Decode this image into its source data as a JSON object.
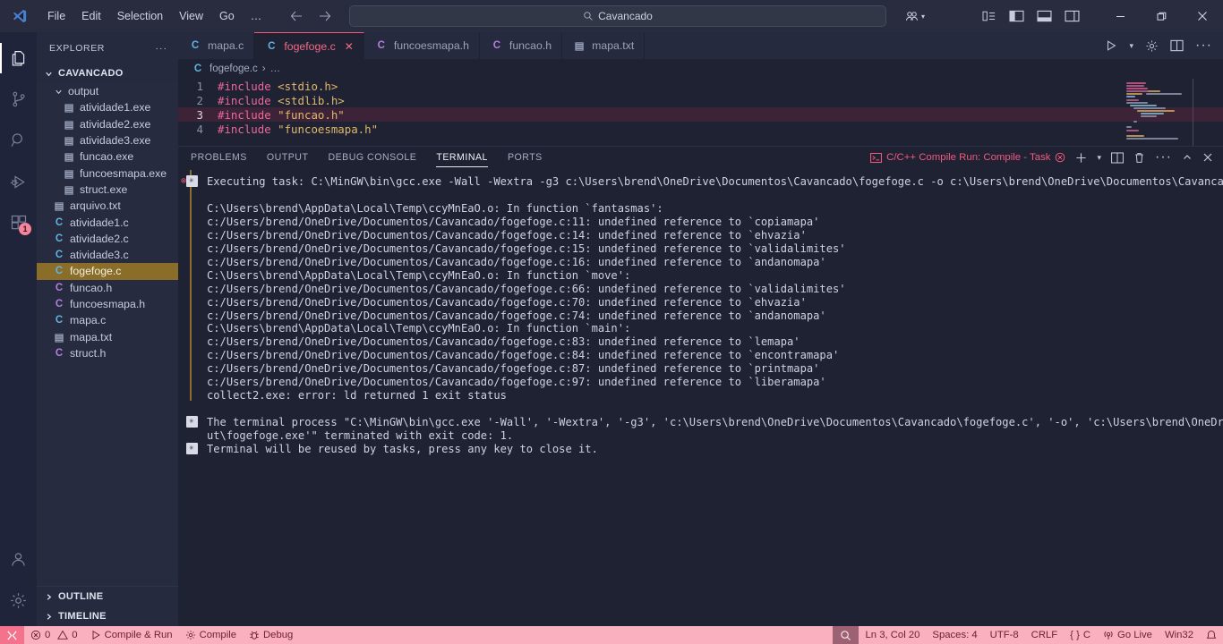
{
  "titlebar": {
    "menus": [
      "File",
      "Edit",
      "Selection",
      "View",
      "Go",
      "…"
    ],
    "back_icon": "arrow-left-icon",
    "forward_icon": "arrow-right-icon",
    "search_value": "Cavancado",
    "search_icon": "search-icon",
    "account_icon": "accounts-icon",
    "layout_icons": [
      "customize-layout-icon",
      "toggle-primary-sidebar-icon",
      "toggle-panel-icon",
      "toggle-secondary-sidebar-icon"
    ],
    "window_controls": [
      "minimize",
      "restore",
      "close"
    ]
  },
  "activitybar": {
    "items": [
      {
        "name": "explorer",
        "icon": "files-icon",
        "active": true,
        "badge": ""
      },
      {
        "name": "source-control",
        "icon": "source-control-icon",
        "active": false,
        "badge": ""
      },
      {
        "name": "search",
        "icon": "search-icon",
        "active": false,
        "badge": ""
      },
      {
        "name": "run-and-debug",
        "icon": "run-debug-icon",
        "active": false,
        "badge": ""
      },
      {
        "name": "extensions",
        "icon": "extensions-icon",
        "active": false,
        "badge": "1"
      }
    ],
    "bottom": [
      {
        "name": "accounts",
        "icon": "account-icon"
      },
      {
        "name": "manage",
        "icon": "gear-icon"
      }
    ]
  },
  "sidebar": {
    "title": "EXPLORER",
    "more_icon": "ellipsis-icon",
    "root": "CAVANCADO",
    "tree": [
      {
        "label": "output",
        "kind": "folder",
        "depth": 1,
        "expanded": true,
        "selected": false
      },
      {
        "label": "atividade1.exe",
        "kind": "exe",
        "depth": 2,
        "selected": false
      },
      {
        "label": "atividade2.exe",
        "kind": "exe",
        "depth": 2,
        "selected": false
      },
      {
        "label": "atividade3.exe",
        "kind": "exe",
        "depth": 2,
        "selected": false
      },
      {
        "label": "funcao.exe",
        "kind": "exe",
        "depth": 2,
        "selected": false
      },
      {
        "label": "funcoesmapa.exe",
        "kind": "exe",
        "depth": 2,
        "selected": false
      },
      {
        "label": "struct.exe",
        "kind": "exe",
        "depth": 2,
        "selected": false
      },
      {
        "label": "arquivo.txt",
        "kind": "txt",
        "depth": 1,
        "selected": false
      },
      {
        "label": "atividade1.c",
        "kind": "c",
        "depth": 1,
        "selected": false
      },
      {
        "label": "atividade2.c",
        "kind": "c",
        "depth": 1,
        "selected": false
      },
      {
        "label": "atividade3.c",
        "kind": "c",
        "depth": 1,
        "selected": false
      },
      {
        "label": "fogefoge.c",
        "kind": "c",
        "depth": 1,
        "selected": true
      },
      {
        "label": "funcao.h",
        "kind": "h",
        "depth": 1,
        "selected": false
      },
      {
        "label": "funcoesmapa.h",
        "kind": "h",
        "depth": 1,
        "selected": false
      },
      {
        "label": "mapa.c",
        "kind": "c",
        "depth": 1,
        "selected": false
      },
      {
        "label": "mapa.txt",
        "kind": "txt",
        "depth": 1,
        "selected": false
      },
      {
        "label": "struct.h",
        "kind": "h",
        "depth": 1,
        "selected": false
      }
    ],
    "footer": [
      "OUTLINE",
      "TIMELINE"
    ]
  },
  "editor": {
    "tabs": [
      {
        "label": "mapa.c",
        "kind": "c",
        "active": false,
        "closable": false
      },
      {
        "label": "fogefoge.c",
        "kind": "c",
        "active": true,
        "closable": true
      },
      {
        "label": "funcoesmapa.h",
        "kind": "h",
        "active": false,
        "closable": false
      },
      {
        "label": "funcao.h",
        "kind": "h",
        "active": false,
        "closable": false
      },
      {
        "label": "mapa.txt",
        "kind": "txt",
        "active": false,
        "closable": false
      }
    ],
    "actions": [
      "run-icon",
      "chevron-down-icon",
      "gear-icon",
      "split-editor-icon",
      "ellipsis-icon"
    ],
    "breadcrumb": {
      "file": "fogefoge.c",
      "sep": "›",
      "rest": "…",
      "kind": "c"
    },
    "lines": [
      {
        "no": "1",
        "current": false,
        "parts": [
          {
            "t": "#include ",
            "c": "kw"
          },
          {
            "t": "<stdio.h>",
            "c": "str"
          }
        ]
      },
      {
        "no": "2",
        "current": false,
        "parts": [
          {
            "t": "#include ",
            "c": "kw"
          },
          {
            "t": "<stdlib.h>",
            "c": "str"
          }
        ]
      },
      {
        "no": "3",
        "current": true,
        "parts": [
          {
            "t": "#include ",
            "c": "kw"
          },
          {
            "t": "\"funcao.h\"",
            "c": "str"
          }
        ]
      },
      {
        "no": "4",
        "current": false,
        "parts": [
          {
            "t": "#include ",
            "c": "kw"
          },
          {
            "t": "\"funcoesmapa.h\"",
            "c": "str"
          }
        ]
      }
    ]
  },
  "panel": {
    "tabs": [
      {
        "label": "PROBLEMS",
        "active": false
      },
      {
        "label": "OUTPUT",
        "active": false
      },
      {
        "label": "DEBUG CONSOLE",
        "active": false
      },
      {
        "label": "TERMINAL",
        "active": true
      },
      {
        "label": "PORTS",
        "active": false
      }
    ],
    "task_icon": "terminal-icon",
    "task_label": "C/C++ Compile Run: Compile - Task",
    "task_kill_icon": "kill-task-icon",
    "actions": [
      "new-terminal-icon",
      "chevron-down-icon",
      "split-terminal-icon",
      "trash-icon",
      "ellipsis-icon",
      "chevron-up-icon",
      "close-icon"
    ]
  },
  "terminal": {
    "lines": [
      {
        "marker": "task",
        "error": true,
        "text": "Executing task: C:\\MinGW\\bin\\gcc.exe -Wall -Wextra -g3 c:\\Users\\brend\\OneDrive\\Documentos\\Cavancado\\fogefoge.c -o c:\\Users\\brend\\OneDrive\\Documentos\\Cavancado\\output\\fogefoge.exe"
      },
      {
        "marker": "none",
        "text": ""
      },
      {
        "marker": "none",
        "text": "C:\\Users\\brend\\AppData\\Local\\Temp\\ccyMnEaO.o: In function `fantasmas':"
      },
      {
        "marker": "none",
        "text": "c:/Users/brend/OneDrive/Documentos/Cavancado/fogefoge.c:11: undefined reference to `copiamapa'"
      },
      {
        "marker": "none",
        "text": "c:/Users/brend/OneDrive/Documentos/Cavancado/fogefoge.c:14: undefined reference to `ehvazia'"
      },
      {
        "marker": "none",
        "text": "c:/Users/brend/OneDrive/Documentos/Cavancado/fogefoge.c:15: undefined reference to `validalimites'"
      },
      {
        "marker": "none",
        "text": "c:/Users/brend/OneDrive/Documentos/Cavancado/fogefoge.c:16: undefined reference to `andanomapa'"
      },
      {
        "marker": "none",
        "text": "C:\\Users\\brend\\AppData\\Local\\Temp\\ccyMnEaO.o: In function `move':"
      },
      {
        "marker": "none",
        "text": "c:/Users/brend/OneDrive/Documentos/Cavancado/fogefoge.c:66: undefined reference to `validalimites'"
      },
      {
        "marker": "none",
        "text": "c:/Users/brend/OneDrive/Documentos/Cavancado/fogefoge.c:70: undefined reference to `ehvazia'"
      },
      {
        "marker": "none",
        "text": "c:/Users/brend/OneDrive/Documentos/Cavancado/fogefoge.c:74: undefined reference to `andanomapa'"
      },
      {
        "marker": "none",
        "text": "C:\\Users\\brend\\AppData\\Local\\Temp\\ccyMnEaO.o: In function `main':"
      },
      {
        "marker": "none",
        "text": "c:/Users/brend/OneDrive/Documentos/Cavancado/fogefoge.c:83: undefined reference to `lemapa'"
      },
      {
        "marker": "none",
        "text": "c:/Users/brend/OneDrive/Documentos/Cavancado/fogefoge.c:84: undefined reference to `encontramapa'"
      },
      {
        "marker": "none",
        "text": "c:/Users/brend/OneDrive/Documentos/Cavancado/fogefoge.c:87: undefined reference to `printmapa'"
      },
      {
        "marker": "none",
        "text": "c:/Users/brend/OneDrive/Documentos/Cavancado/fogefoge.c:97: undefined reference to `liberamapa'"
      },
      {
        "marker": "none",
        "text": "collect2.exe: error: ld returned 1 exit status"
      },
      {
        "marker": "none",
        "text": ""
      },
      {
        "marker": "task",
        "error": false,
        "text": "The terminal process \"C:\\MinGW\\bin\\gcc.exe '-Wall', '-Wextra', '-g3', 'c:\\Users\\brend\\OneDrive\\Documentos\\Cavancado\\fogefoge.c', '-o', 'c:\\Users\\brend\\OneDrive\\Documentos\\Cavancado\\outp"
      },
      {
        "marker": "none",
        "text": "ut\\fogefoge.exe'\" terminated with exit code: 1."
      },
      {
        "marker": "task",
        "error": false,
        "text": "Terminal will be reused by tasks, press any key to close it."
      }
    ]
  },
  "statusbar": {
    "remote_icon": "remote-window-icon",
    "left": [
      {
        "name": "problems",
        "icon": "error-icon",
        "text": "0",
        "icon2": "warning-icon",
        "text2": "0"
      },
      {
        "name": "compile-and-run",
        "icon": "play-icon",
        "text": "Compile & Run"
      },
      {
        "name": "compile",
        "icon": "gear-icon",
        "text": "Compile"
      },
      {
        "name": "debug",
        "icon": "bug-icon",
        "text": "Debug"
      }
    ],
    "search_icon": "search-status-icon",
    "right": [
      {
        "name": "cursor-position",
        "text": "Ln 3, Col 20"
      },
      {
        "name": "indentation",
        "text": "Spaces: 4"
      },
      {
        "name": "encoding",
        "text": "UTF-8"
      },
      {
        "name": "eol",
        "text": "CRLF"
      },
      {
        "name": "language-mode",
        "text": "C",
        "icon": "braces-icon"
      },
      {
        "name": "go-live",
        "text": "Go Live",
        "icon": "broadcast-icon"
      },
      {
        "name": "platform",
        "text": "Win32"
      }
    ],
    "bell_icon": "bell-icon"
  },
  "colors": {
    "accent_pink": "#f3597d",
    "status_bg": "#fbb0bf",
    "selection_gold": "#8a6d28",
    "editor_bg": "#1e2233",
    "sidebar_bg": "#252a3e"
  }
}
